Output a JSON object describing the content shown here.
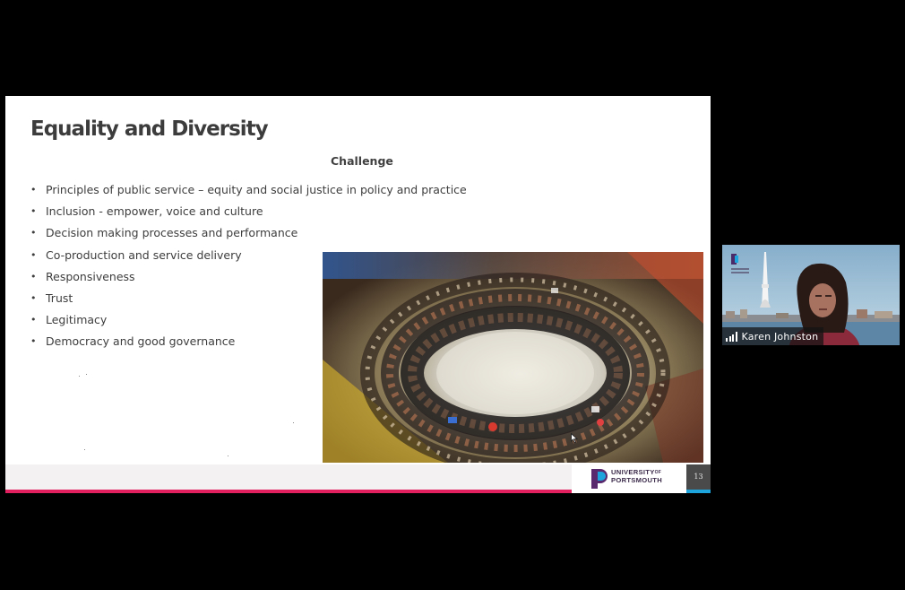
{
  "slide": {
    "title": "Equality and Diversity",
    "subtitle": "Challenge",
    "bullets": [
      "Principles of public service – equity and social justice in policy and practice",
      "Inclusion -  empower, voice and culture",
      "Decision making processes and performance",
      "Co-production and service delivery",
      "Responsiveness",
      "Trust",
      "Legitimacy",
      "Democracy and good governance"
    ],
    "image_icon": "group-meeting-photo",
    "page_number": "13",
    "logo": {
      "line1": "UNIVERSITY",
      "of": "OF",
      "line2": "PORTSMOUTH"
    },
    "colors": {
      "accent_pink": "#e2205f",
      "accent_blue": "#1ea4dc",
      "logo_purple": "#3b2a4a"
    }
  },
  "participant": {
    "name": "Karen Johnston",
    "signal_icon": "signal-bars-icon"
  }
}
